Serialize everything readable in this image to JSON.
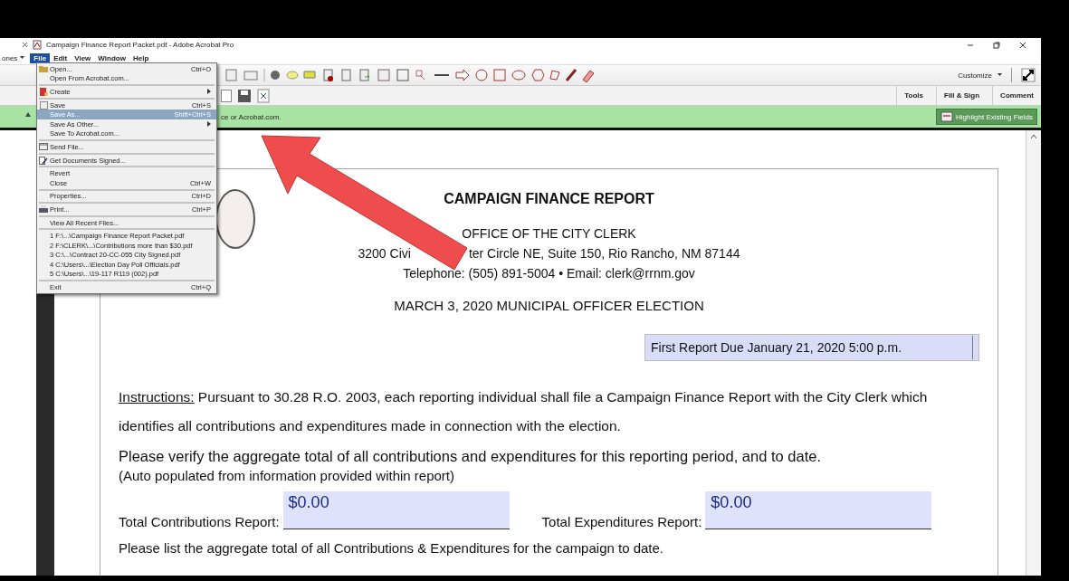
{
  "window": {
    "title": "Campaign Finance Report Packet.pdf - Adobe Acrobat Pro"
  },
  "left_panel": {
    "menu_label": "ones"
  },
  "menu_bar": [
    {
      "label": "File",
      "selected": true
    },
    {
      "label": "Edit",
      "selected": false
    },
    {
      "label": "View",
      "selected": false
    },
    {
      "label": "Window",
      "selected": false
    },
    {
      "label": "Help",
      "selected": false
    }
  ],
  "toolbar": {
    "customize": "Customize"
  },
  "task_tabs": [
    "Tools",
    "Fill & Sign",
    "Comment"
  ],
  "notice_bar": {
    "text": "ce or Acrobat.com.",
    "button": "Highlight Existing Fields"
  },
  "file_menu": [
    {
      "kind": "item",
      "label": "Open...",
      "shortcut": "Ctrl+O",
      "submenu": false,
      "selected": false
    },
    {
      "kind": "item",
      "label": "Open From Acrobat.com...",
      "submenu": false,
      "selected": false
    },
    {
      "kind": "separator"
    },
    {
      "kind": "item",
      "label": "Create",
      "submenu": true,
      "selected": false
    },
    {
      "kind": "separator"
    },
    {
      "kind": "item",
      "label": "Save",
      "shortcut": "Ctrl+S",
      "submenu": false,
      "selected": false
    },
    {
      "kind": "item",
      "label": "Save As...",
      "shortcut": "Shift+Ctrl+S",
      "submenu": false,
      "selected": true
    },
    {
      "kind": "item",
      "label": "Save As Other...",
      "submenu": true,
      "selected": false
    },
    {
      "kind": "item",
      "label": "Save To Acrobat.com...",
      "submenu": false,
      "selected": false
    },
    {
      "kind": "separator"
    },
    {
      "kind": "item",
      "label": "Send File...",
      "submenu": false,
      "selected": false
    },
    {
      "kind": "separator"
    },
    {
      "kind": "item",
      "label": "Get Documents Signed...",
      "submenu": false,
      "selected": false
    },
    {
      "kind": "separator"
    },
    {
      "kind": "item",
      "label": "Revert",
      "submenu": false,
      "selected": false
    },
    {
      "kind": "item",
      "label": "Close",
      "shortcut": "Ctrl+W",
      "submenu": false,
      "selected": false
    },
    {
      "kind": "separator"
    },
    {
      "kind": "item",
      "label": "Properties...",
      "shortcut": "Ctrl+D",
      "submenu": false,
      "selected": false
    },
    {
      "kind": "separator"
    },
    {
      "kind": "item",
      "label": "Print...",
      "shortcut": "Ctrl+P",
      "submenu": false,
      "selected": false
    },
    {
      "kind": "separator"
    },
    {
      "kind": "item",
      "label": "View All Recent Files...",
      "submenu": false,
      "selected": false
    },
    {
      "kind": "separator"
    },
    {
      "kind": "item",
      "label": "1 F:\\...\\Campaign Finance Report Packet.pdf",
      "submenu": false,
      "selected": false
    },
    {
      "kind": "item",
      "label": "2 F:\\CLERK\\...\\Contributions more than $30.pdf",
      "submenu": false,
      "selected": false
    },
    {
      "kind": "item",
      "label": "3 C:\\...\\Contract 20-CC-055 City Signed.pdf",
      "submenu": false,
      "selected": false
    },
    {
      "kind": "item",
      "label": "4 C:\\Users\\...\\Election Day Poll Officials.pdf",
      "submenu": false,
      "selected": false
    },
    {
      "kind": "item",
      "label": "5 C:\\Users\\...\\19-117 R119 (002).pdf",
      "submenu": false,
      "selected": false
    },
    {
      "kind": "separator"
    },
    {
      "kind": "item",
      "label": "Exit",
      "shortcut": "Ctrl+Q",
      "submenu": false,
      "selected": false
    }
  ],
  "document": {
    "title": "CAMPAIGN FINANCE REPORT",
    "office": "OFFICE OF THE CITY CLERK",
    "address_start": "3200 Civi",
    "address_end": "ter Circle NE, Suite 150, Rio Rancho, NM 87144",
    "contact": "Telephone: (505) 891-5004 • Email: clerk@rrnm.gov",
    "election": "MARCH 3, 2020 MUNICIPAL OFFICER ELECTION",
    "report_select": "First Report Due January 21, 2020 5:00 p.m.",
    "instructions_label": "Instructions:",
    "instructions": "Pursuant to 30.28 R.O. 2003, each reporting individual shall file a Campaign Finance Report with the City Clerk which identifies all contributions and expenditures made in connection with the election.",
    "verify": "Please verify the aggregate total of all contributions and expenditures for this reporting period, and to date.",
    "auto_note": "(Auto populated from information provided within report)",
    "fields": [
      {
        "label": "Total Contributions Report:",
        "value": "$0.00"
      },
      {
        "label": "Total Expenditures Report:",
        "value": "$0.00"
      }
    ],
    "list_note": "Please list the aggregate total of all Contributions & Expenditures for the campaign to date."
  }
}
